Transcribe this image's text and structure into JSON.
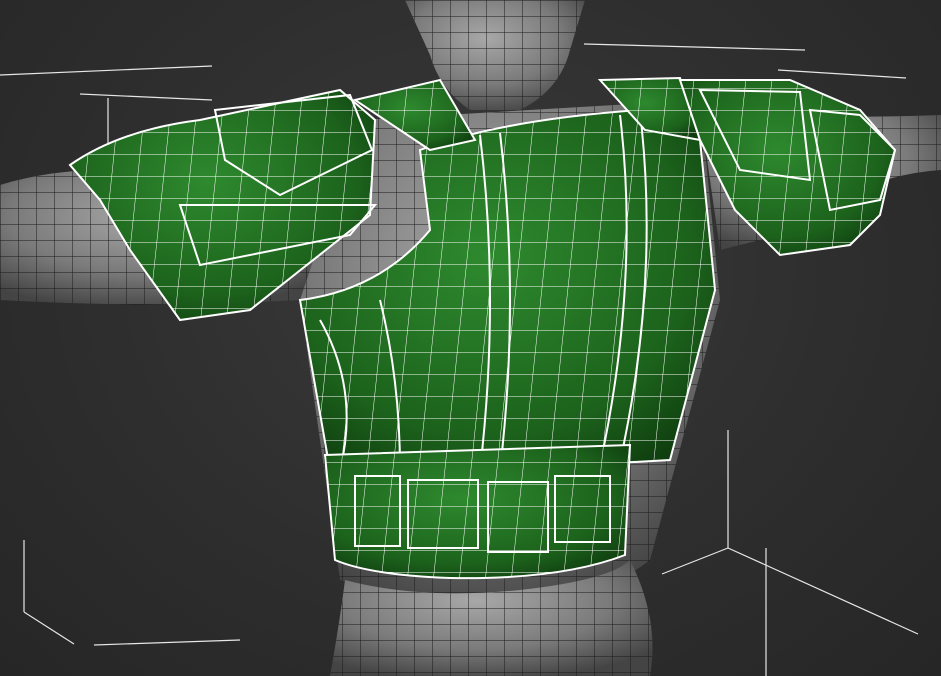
{
  "viewport": {
    "kind": "3d-perspective-viewport",
    "display_mode": "smooth-shaded-with-edged-faces"
  },
  "scene": {
    "background_color": "#2e2e2e",
    "body_mesh": {
      "name": "character-body",
      "shade_color": "#8a8a8a",
      "wire_color": "#1a1a1a"
    },
    "armor_mesh": {
      "name": "armor",
      "shade_color": "#1f6e1f",
      "wire_color": "#ffffff"
    },
    "bounding_box_color": "#e6e6e6"
  },
  "icons": {
    "bounding_box": "selection-bracket-icon"
  }
}
